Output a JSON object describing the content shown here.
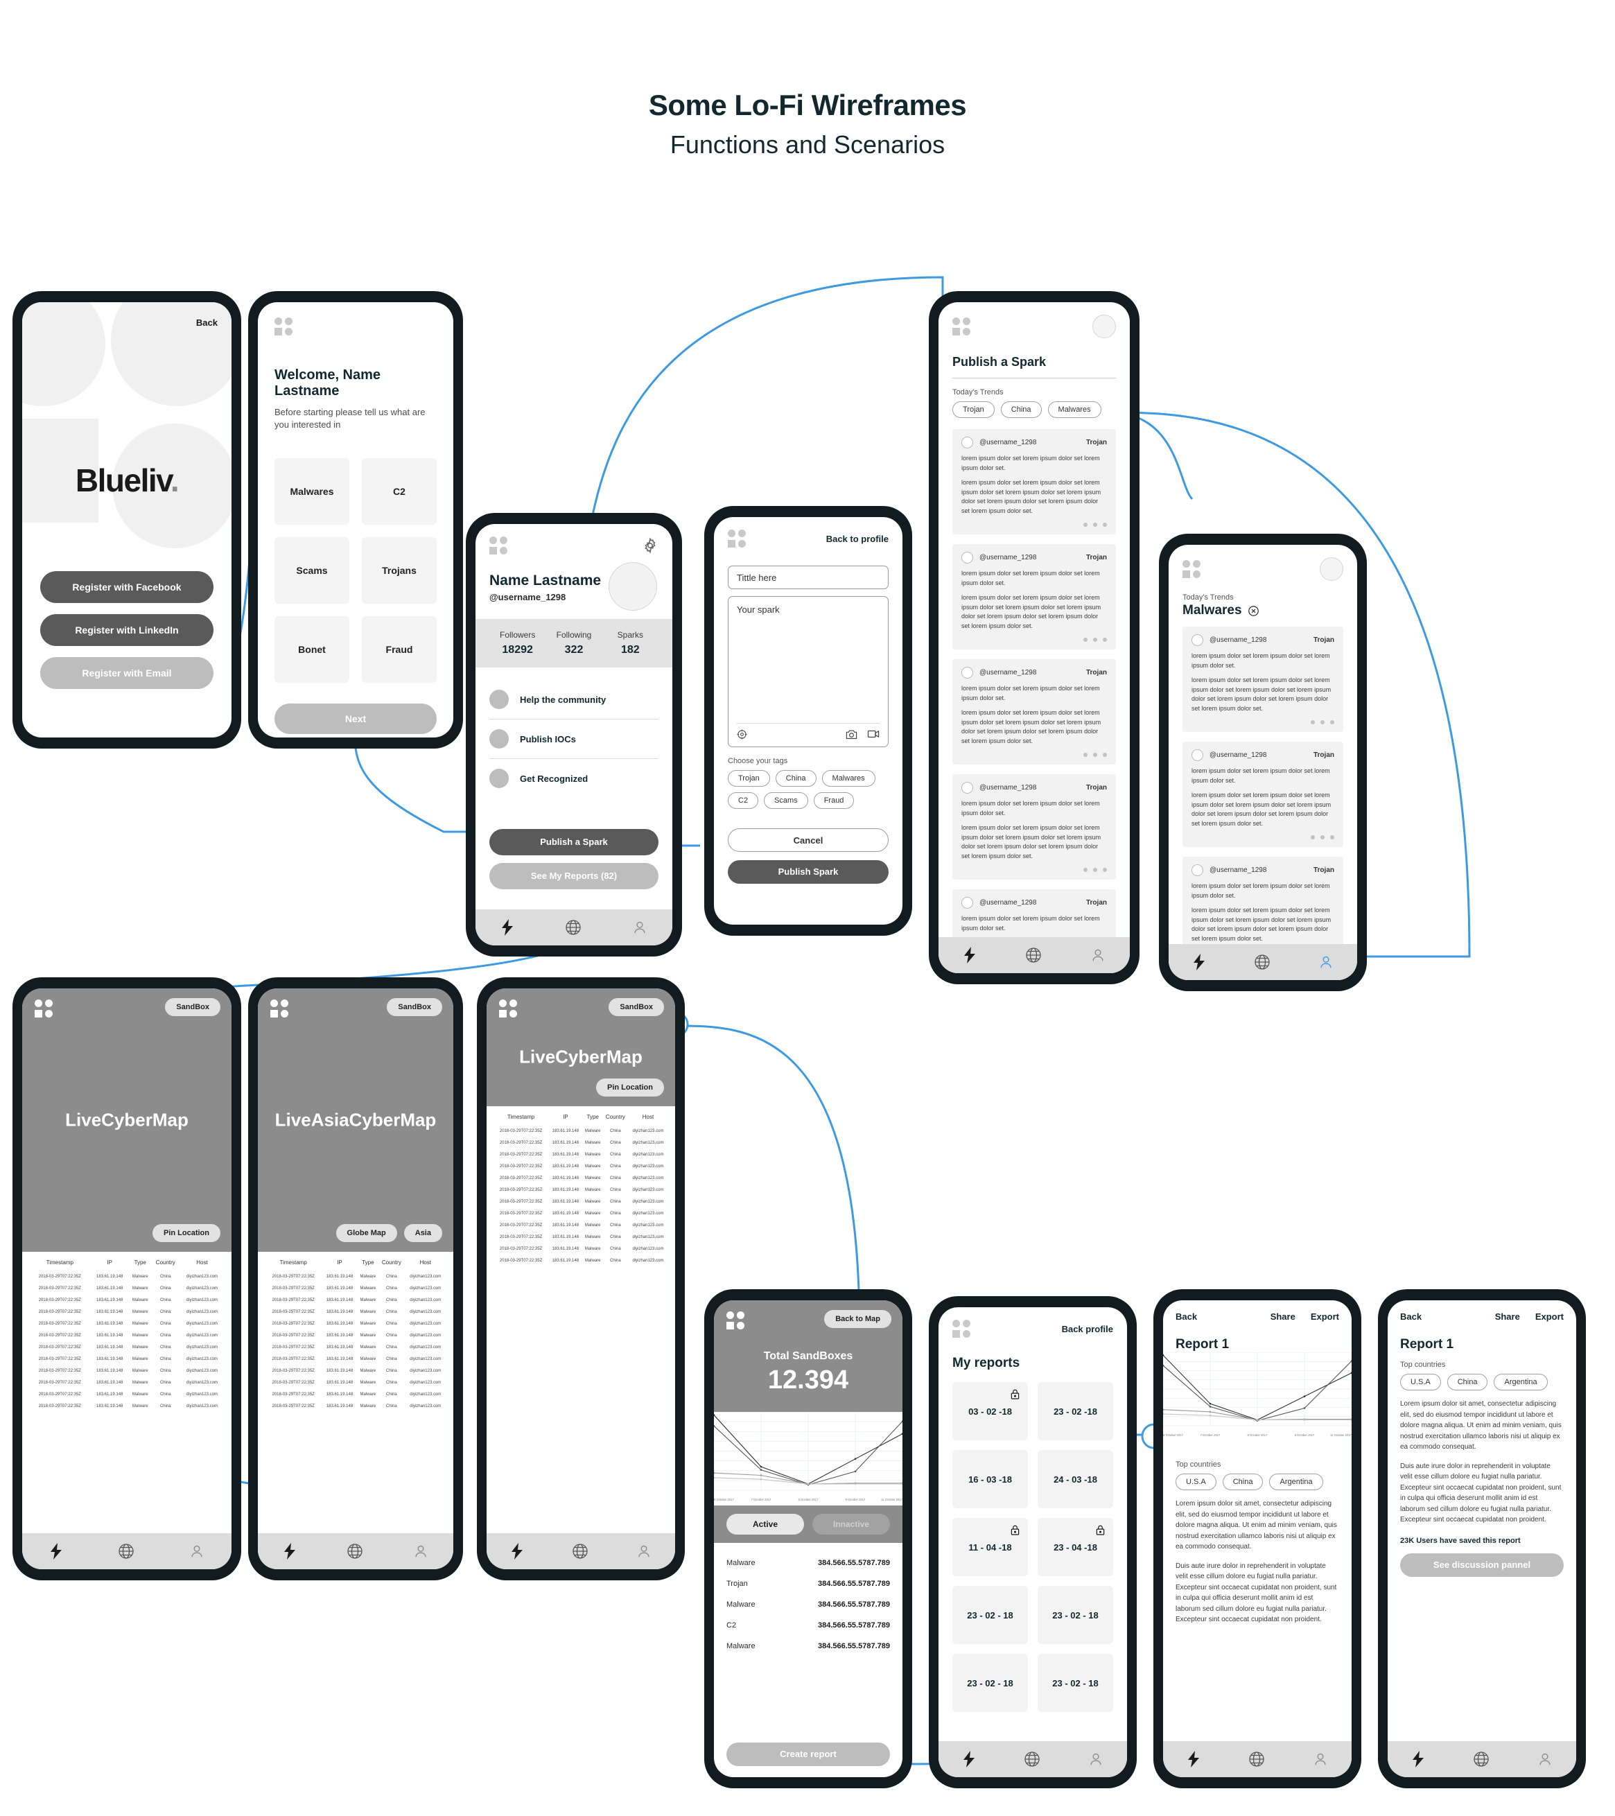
{
  "page": {
    "title": "Some Lo-Fi Wireframes",
    "subtitle": "Functions and Scenarios",
    "accent_blue": "#3d9ae2",
    "frame_color": "#121c20"
  },
  "splash": {
    "back_label": "Back",
    "brand": "Blueliv",
    "brand_dot": ".",
    "buttons": [
      {
        "label": "Register with Facebook",
        "style": "dark"
      },
      {
        "label": "Register with LinkedIn",
        "style": "dark"
      },
      {
        "label": "Register with Email",
        "style": "grey"
      }
    ]
  },
  "welcome": {
    "heading": "Welcome, Name Lastname",
    "subtext": "Before starting please tell us what are you interested in",
    "interests": [
      "Malwares",
      "C2",
      "Scams",
      "Trojans",
      "Bonet",
      "Fraud"
    ],
    "next_label": "Next"
  },
  "profile": {
    "name": "Name Lastname",
    "username": "@username_1298",
    "stats": [
      {
        "label": "Followers",
        "value": "18292"
      },
      {
        "label": "Following",
        "value": "322"
      },
      {
        "label": "Sparks",
        "value": "182"
      }
    ],
    "menu": [
      "Help the community",
      "Publish IOCs",
      "Get Recognized"
    ],
    "primary_action": "Publish a Spark",
    "secondary_action": "See My Reports (82)"
  },
  "compose": {
    "back_label": "Back to profile",
    "title_placeholder": "Tittle here",
    "body_placeholder": "Your spark",
    "tags_label": "Choose your tags",
    "tags": [
      "Trojan",
      "China",
      "Malwares",
      "C2",
      "Scams",
      "Fraud"
    ],
    "cancel_label": "Cancel",
    "publish_label": "Publish Spark"
  },
  "feed": {
    "heading": "Publish a Spark",
    "trends_label": "Today's Trends",
    "trends": [
      "Trojan",
      "China",
      "Malwares"
    ],
    "post": {
      "username": "@username_1298",
      "tag": "Trojan",
      "line1": "lorem ipsum dolor set lorem ipsum dolor set lorem ipsum dolor set.",
      "line2": "lorem ipsum dolor set lorem ipsum dolor set lorem ipsum dolor set lorem ipsum dolor set lorem ipsum dolor set lorem ipsum dolor set lorem ipsum dolor set lorem ipsum dolor set."
    },
    "post_count": 8
  },
  "filtered": {
    "trends_label": "Today's Trends",
    "active_filter": "Malwares",
    "clear_icon": "close-circle-icon",
    "post_count": 4
  },
  "maps": [
    {
      "chip": "SandBox",
      "title": "LiveCyberMap",
      "footer_buttons": [
        "Pin Location"
      ]
    },
    {
      "chip": "SandBox",
      "title": "LiveAsiaCyberMap",
      "footer_buttons": [
        "Globe Map",
        "Asia"
      ]
    },
    {
      "chip": "SandBox",
      "title": "LiveCyberMap",
      "footer_buttons": [
        "Pin Location"
      ]
    }
  ],
  "table": {
    "columns": [
      "Timestamp",
      "IP",
      "Type",
      "Country",
      "Host"
    ],
    "row": [
      "2018-03-29T07:22:35Z",
      "183.61.19.148",
      "Malware",
      "China",
      "diyizhan123.com"
    ],
    "row_count": 12
  },
  "sandbox": {
    "back_label": "Back to Map",
    "total_label": "Total SandBoxes",
    "total_value": "12.394",
    "toggles": [
      {
        "label": "Active",
        "state": "on"
      },
      {
        "label": "Innactive",
        "state": "off"
      }
    ],
    "rows": [
      {
        "type": "Malware",
        "value": "384.566.55.5787.789"
      },
      {
        "type": "Trojan",
        "value": "384.566.55.5787.789"
      },
      {
        "type": "Malware",
        "value": "384.566.55.5787.789"
      },
      {
        "type": "C2",
        "value": "384.566.55.5787.789"
      },
      {
        "type": "Malware",
        "value": "384.566.55.5787.789"
      }
    ],
    "create_label": "Create report"
  },
  "reports": {
    "back_label": "Back profile",
    "heading": "My reports",
    "items": [
      {
        "date": "03 - 02 -18",
        "locked": true
      },
      {
        "date": "23 - 02 -18",
        "locked": false
      },
      {
        "date": "16 - 03 -18",
        "locked": false
      },
      {
        "date": "24 - 03 -18",
        "locked": false
      },
      {
        "date": "11 - 04 -18",
        "locked": true
      },
      {
        "date": "23 - 04 -18",
        "locked": true
      },
      {
        "date": "23 - 02 - 18",
        "locked": false
      },
      {
        "date": "23 - 02 - 18",
        "locked": false
      },
      {
        "date": "23 - 02 - 18",
        "locked": false
      },
      {
        "date": "23 - 02 - 18",
        "locked": false
      }
    ]
  },
  "report_detail": {
    "back_label": "Back",
    "share_label": "Share",
    "export_label": "Export",
    "heading": "Report 1",
    "countries_label": "Top countries",
    "countries": [
      "U.S.A",
      "China",
      "Argentina"
    ],
    "paragraph1": "Lorem ipsum dolor sit amet, consectetur adipiscing elit, sed do eiusmod tempor incididunt ut labore et dolore magna aliqua. Ut enim ad minim veniam, quis nostrud exercitation ullamco laboris nisi ut aliquip ex ea commodo consequat.",
    "paragraph2": "Duis aute irure dolor in reprehenderit in voluptate velit esse cillum dolore eu fugiat nulla pariatur. Excepteur sint occaecat cupidatat non proident, sunt in culpa qui officia deserunt mollit anim id est laborum sed cillum dolore eu fugiat nulla pariatur. Excepteur sint occaecat cupidatat non proident.",
    "saved_note": "23K Users have saved this report",
    "discussion_label": "See discussion pannel"
  },
  "chart_data": {
    "type": "line",
    "title": "",
    "x": [
      "6 October 2017",
      "7 October 2017",
      "8 October 2017",
      "9 October 2017",
      "11 October 2017"
    ],
    "xlabel": "",
    "ylabel": "",
    "grid": true,
    "legend": "none",
    "series": [
      {
        "name": "series-1",
        "values": [
          96,
          30,
          8,
          40,
          72
        ]
      },
      {
        "name": "series-2",
        "values": [
          82,
          26,
          7,
          24,
          88
        ]
      },
      {
        "name": "series-3",
        "values": [
          22,
          19,
          8,
          9,
          9
        ]
      },
      {
        "name": "series-4",
        "values": [
          16,
          14,
          8,
          8,
          8
        ]
      }
    ],
    "ylim": [
      0,
      100
    ]
  },
  "bottom_nav": {
    "items": [
      {
        "icon": "lightning-bolt-icon",
        "active": true
      },
      {
        "icon": "globe-icon",
        "active": false
      },
      {
        "icon": "person-icon",
        "active": false
      }
    ]
  },
  "icons": {
    "gear": "gear-icon",
    "location": "location-pin-icon",
    "camera": "camera-icon",
    "video": "video-icon",
    "lock": "lock-icon"
  }
}
